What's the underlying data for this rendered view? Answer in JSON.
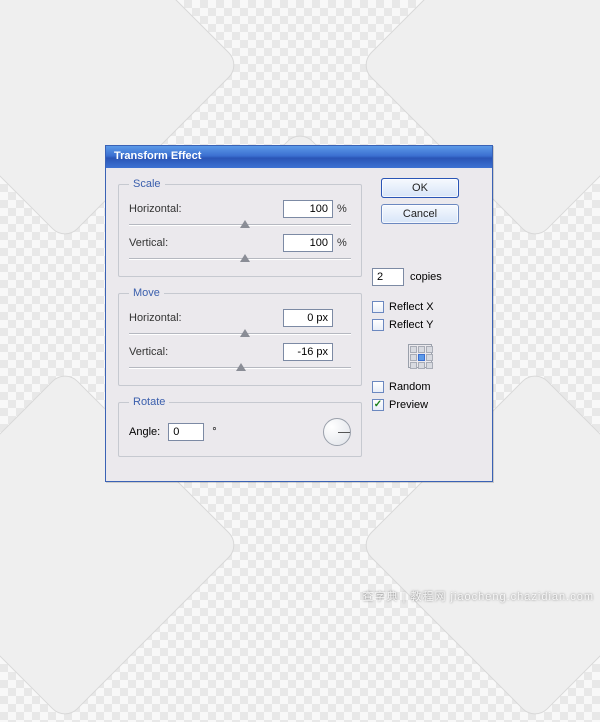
{
  "dialog": {
    "title": "Transform Effect",
    "scale": {
      "legend": "Scale",
      "horizontal_label": "Horizontal:",
      "horizontal_value": "100",
      "horizontal_unit": "%",
      "vertical_label": "Vertical:",
      "vertical_value": "100",
      "vertical_unit": "%"
    },
    "move": {
      "legend": "Move",
      "horizontal_label": "Horizontal:",
      "horizontal_value": "0 px",
      "vertical_label": "Vertical:",
      "vertical_value": "-16 px"
    },
    "rotate": {
      "legend": "Rotate",
      "angle_label": "Angle:",
      "angle_value": "0",
      "angle_unit": "°"
    },
    "buttons": {
      "ok": "OK",
      "cancel": "Cancel"
    },
    "copies_value": "2",
    "copies_label": "copies",
    "reflect_x_label": "Reflect X",
    "reflect_y_label": "Reflect Y",
    "random_label": "Random",
    "preview_label": "Preview",
    "reflect_x_checked": false,
    "reflect_y_checked": false,
    "random_checked": false,
    "preview_checked": true
  },
  "watermark": "查字典 | 教程网  jiaocheng.chazidian.com"
}
